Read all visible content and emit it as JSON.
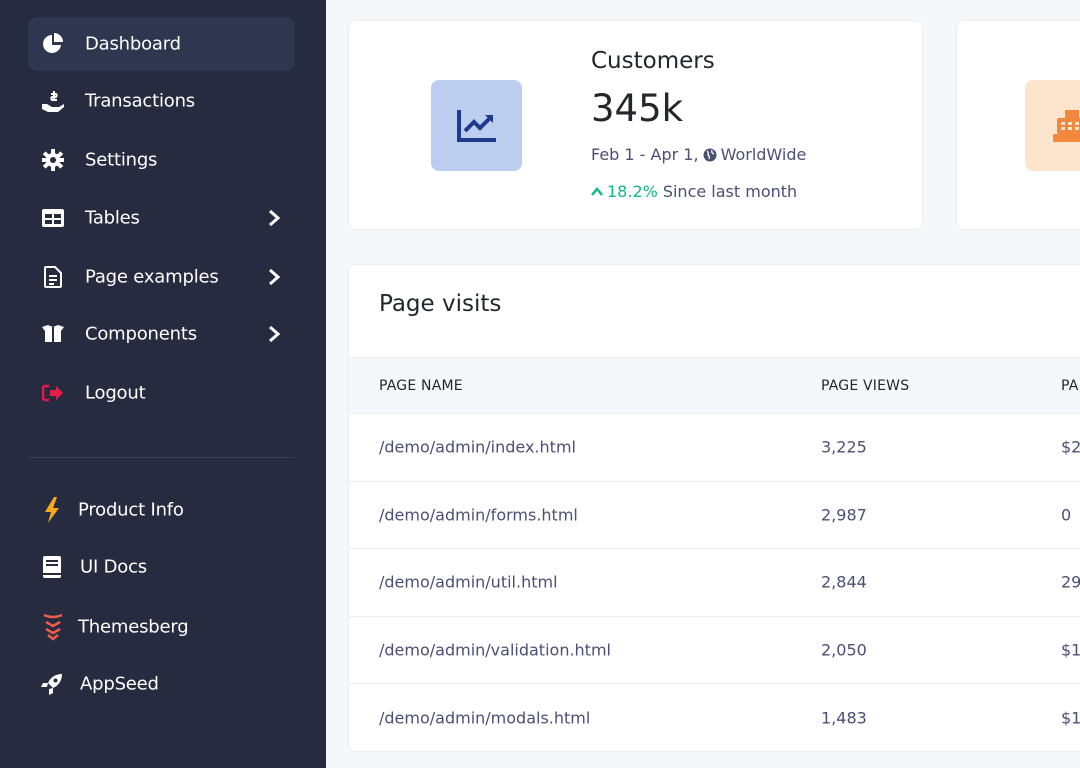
{
  "sidebar": {
    "items": [
      {
        "label": "Dashboard",
        "icon": "chart-pie-icon",
        "active": true
      },
      {
        "label": "Transactions",
        "icon": "hand-coin-icon"
      },
      {
        "label": "Settings",
        "icon": "gear-icon"
      },
      {
        "label": "Tables",
        "icon": "table-icon",
        "has_submenu": true
      },
      {
        "label": "Page examples",
        "icon": "document-icon",
        "has_submenu": true
      },
      {
        "label": "Components",
        "icon": "boxes-icon",
        "has_submenu": true
      },
      {
        "label": "Logout",
        "icon": "logout-icon",
        "color": "#e11d48"
      }
    ],
    "bottom_items": [
      {
        "label": "Product Info",
        "icon": "bolt-icon",
        "color": "#fba918"
      },
      {
        "label": "UI Docs",
        "icon": "book-icon"
      },
      {
        "label": "Themesberg",
        "icon": "themesberg-logo-icon",
        "color": "#f05d4b"
      },
      {
        "label": "AppSeed",
        "icon": "rocket-icon"
      }
    ]
  },
  "stat_card": {
    "title": "Customers",
    "value": "345k",
    "range": "Feb 1 - Apr 1,",
    "region": "WorldWide",
    "change_pct": "18.2%",
    "change_text": "Since last month",
    "icon": "chart-line-icon",
    "accent": "#10b981"
  },
  "stat_card_2": {
    "icon": "cash-register-icon"
  },
  "page_visits": {
    "title": "Page visits",
    "columns": [
      "PAGE NAME",
      "PAGE VIEWS",
      "PA"
    ],
    "rows": [
      {
        "name": "/demo/admin/index.html",
        "views": "3,225",
        "value": "$2"
      },
      {
        "name": "/demo/admin/forms.html",
        "views": "2,987",
        "value": "0"
      },
      {
        "name": "/demo/admin/util.html",
        "views": "2,844",
        "value": "29"
      },
      {
        "name": "/demo/admin/validation.html",
        "views": "2,050",
        "value": "$1"
      },
      {
        "name": "/demo/admin/modals.html",
        "views": "1,483",
        "value": "$1"
      }
    ]
  }
}
